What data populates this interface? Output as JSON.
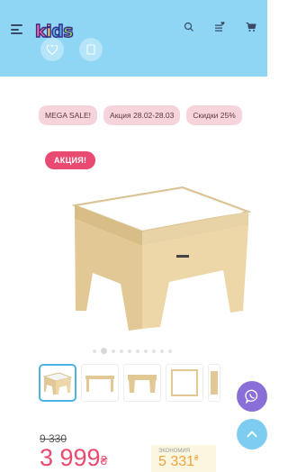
{
  "header": {
    "logo_letters": [
      "k",
      "i",
      "d",
      "s"
    ],
    "logo_colors": [
      "#ff6b9a",
      "#ffd84d",
      "#4db2e0",
      "#8cd26b"
    ]
  },
  "promotions": [
    "MEGA SALE!",
    "Акция 28.02-28.03",
    "Скидки 25%"
  ],
  "badge": "АКЦИЯ!",
  "gallery": {
    "slides": 10,
    "active_index": 1
  },
  "price": {
    "old": "9 330",
    "current": "3 999",
    "currency": "₴",
    "savings_label": "ЭКОНОМИЯ",
    "savings": "5 331"
  },
  "colors": {
    "accent": "#e94a71",
    "hero": "#8fd6f4",
    "viber": "#8b6fd8",
    "scroll_top": "#4db2e0"
  }
}
